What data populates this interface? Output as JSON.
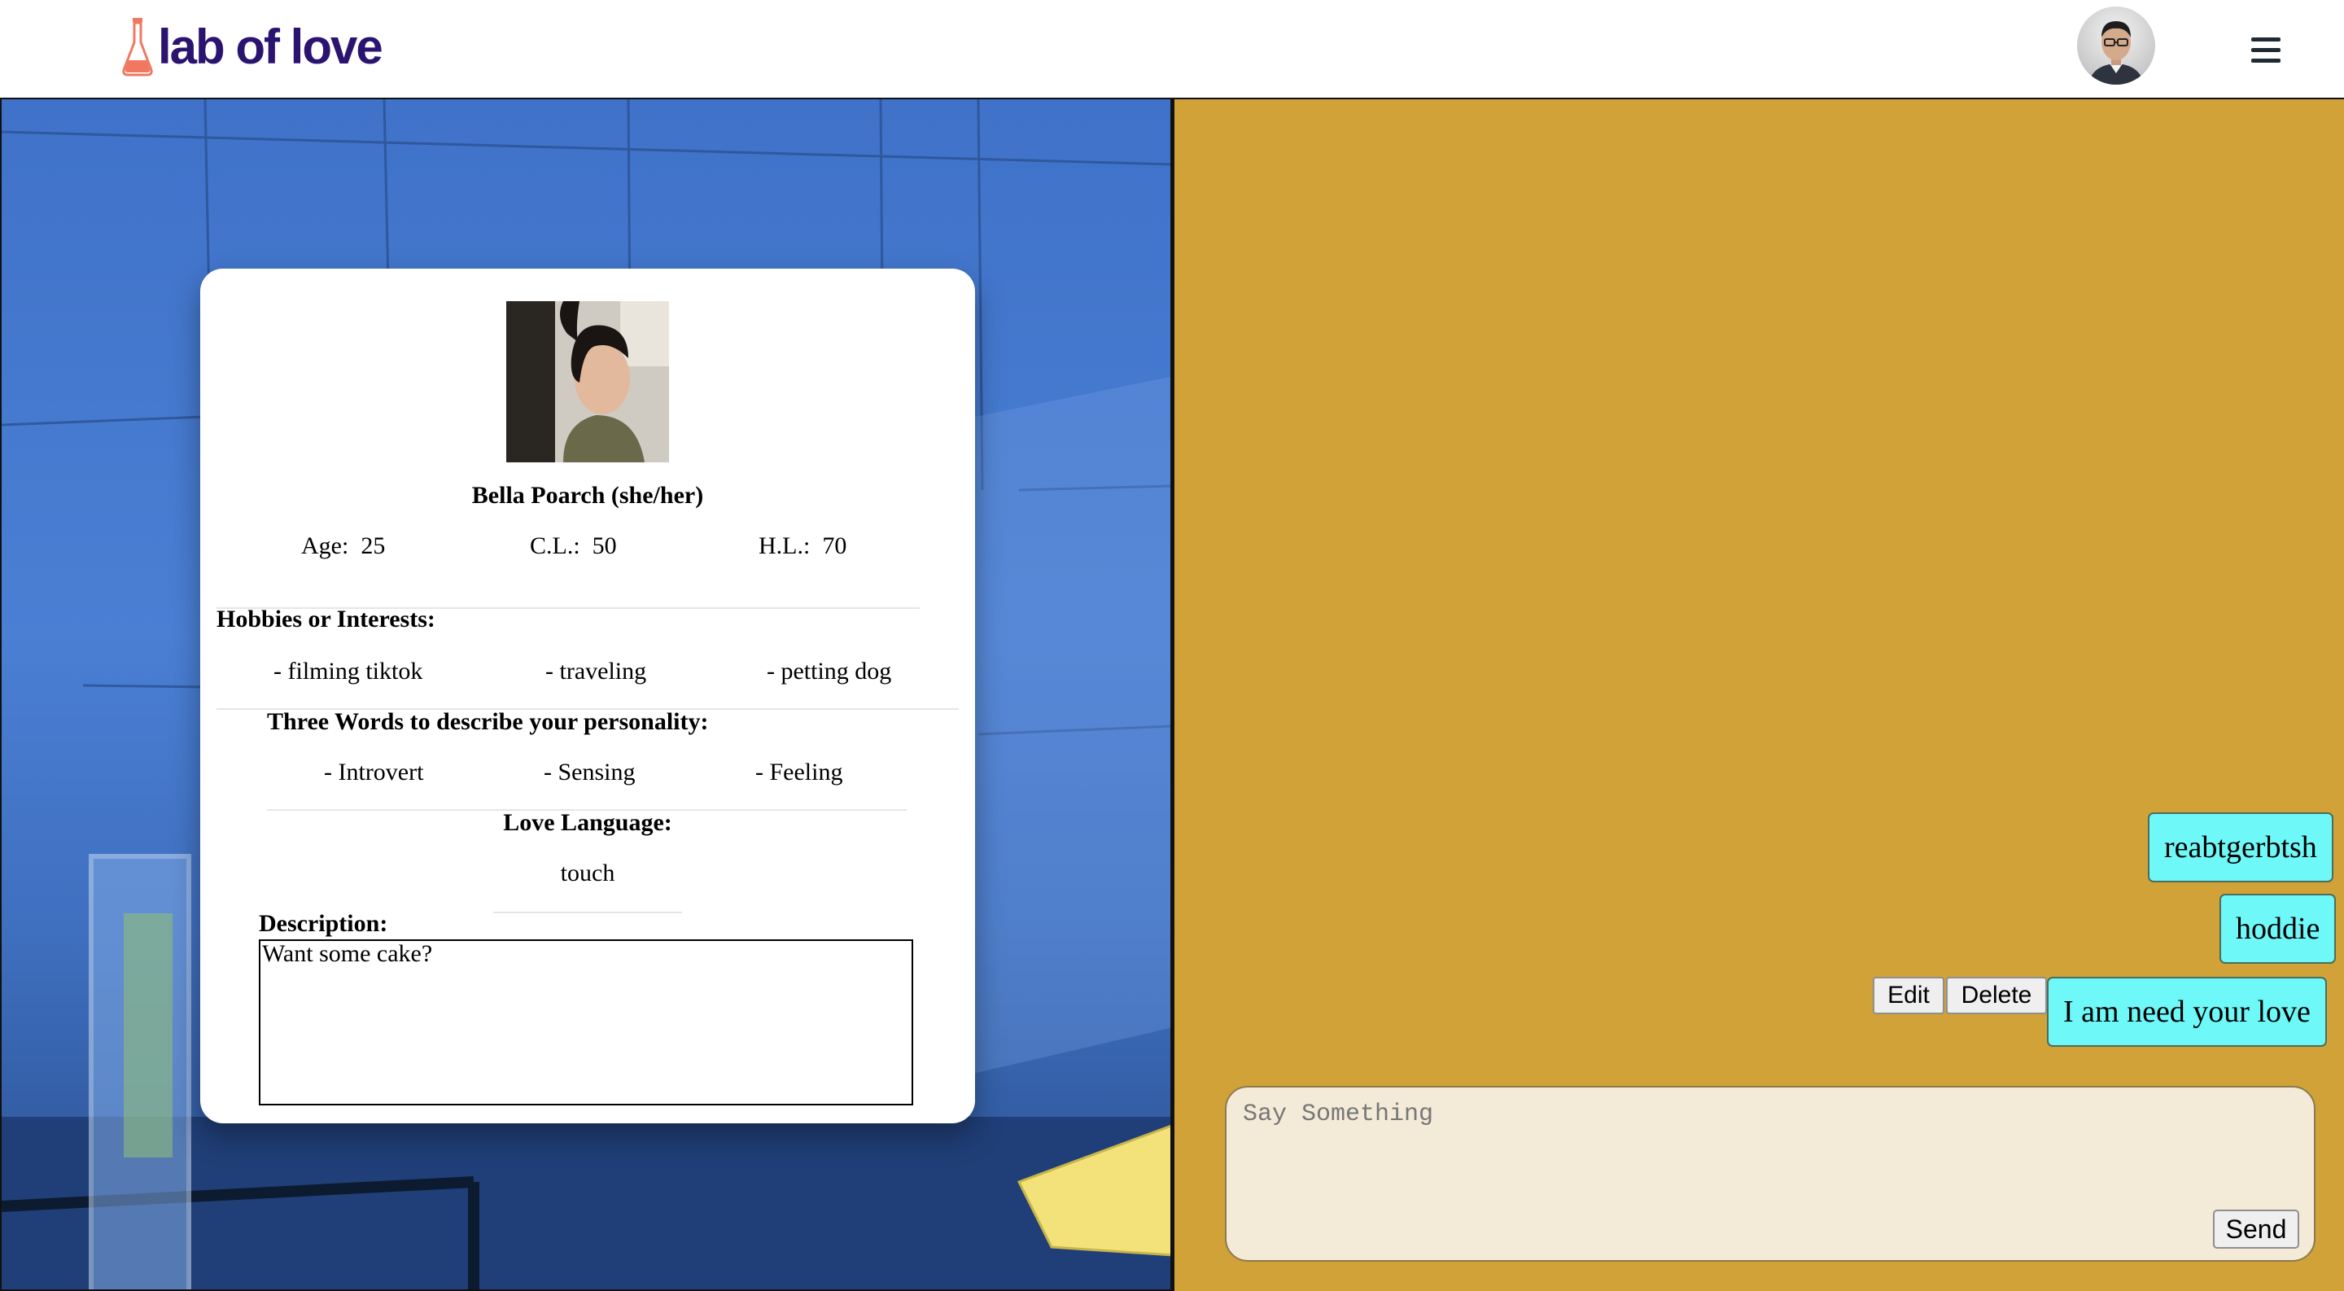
{
  "header": {
    "logo_text": "lab of love",
    "avatar_icon": "user-avatar",
    "menu_icon": "hamburger-menu-icon"
  },
  "profile": {
    "name": "Bella Poarch (she/her)",
    "stats": [
      {
        "label": "Age:",
        "value": "25"
      },
      {
        "label": "C.L.:",
        "value": "50"
      },
      {
        "label": "H.L.:",
        "value": "70"
      }
    ],
    "hobbies_title": "Hobbies or Interests:",
    "hobbies": [
      "- filming tiktok",
      "- traveling",
      "- petting dog"
    ],
    "personality_title": "Three Words to describe your personality:",
    "personality": [
      "- Introvert",
      "- Sensing",
      "- Feeling"
    ],
    "love_language_title": "Love Language:",
    "love_language": "touch",
    "description_title": "Description:",
    "description": "Want some cake?"
  },
  "chat": {
    "messages": [
      {
        "text": "reabtgerbtsh"
      },
      {
        "text": "hoddie"
      },
      {
        "text": "I am need your love"
      }
    ],
    "edit_label": "Edit",
    "delete_label": "Delete",
    "input_placeholder": "Say Something",
    "send_label": "Send"
  },
  "colors": {
    "brand": "#2b1470",
    "chat_bg": "#d1a238",
    "bubble": "#6ff8f8",
    "composer_bg": "#f3ead7"
  }
}
